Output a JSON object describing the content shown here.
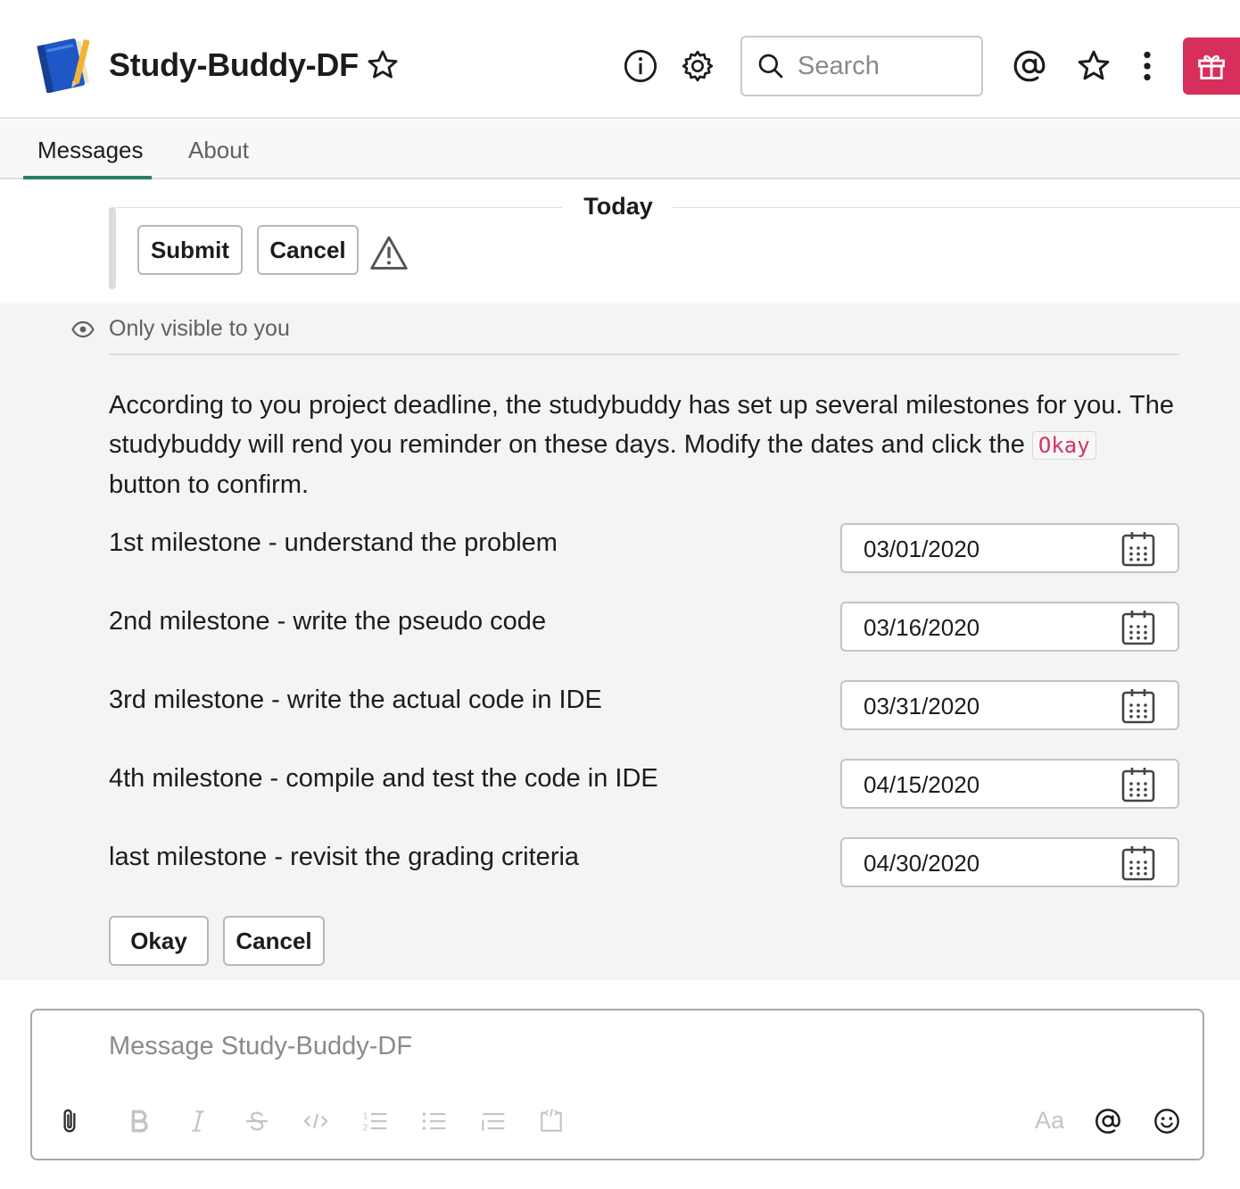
{
  "header": {
    "title": "Study-Buddy-DF",
    "search_placeholder": "Search"
  },
  "tabs": [
    {
      "label": "Messages",
      "active": true
    },
    {
      "label": "About",
      "active": false
    }
  ],
  "day_divider": "Today",
  "prev_message": {
    "submit_label": "Submit",
    "cancel_label": "Cancel"
  },
  "ephemeral": {
    "visibility_note": "Only visible to you",
    "body_part1": "According to you project deadline, the studybuddy has set up several milestones for you. The studybuddy will rend you reminder on these days. Modify the dates and click the ",
    "body_code": "Okay",
    "body_part2": " button to confirm.",
    "milestones": [
      {
        "label": "1st milestone - understand the problem",
        "date": "03/01/2020"
      },
      {
        "label": "2nd milestone - write the pseudo code",
        "date": "03/16/2020"
      },
      {
        "label": "3rd milestone - write the actual code in IDE",
        "date": "03/31/2020"
      },
      {
        "label": "4th milestone - compile and test the code in IDE",
        "date": "04/15/2020"
      },
      {
        "label": "last milestone - revisit the grading criteria",
        "date": "04/30/2020"
      }
    ],
    "okay_label": "Okay",
    "cancel_label": "Cancel"
  },
  "composer": {
    "placeholder": "Message Study-Buddy-DF",
    "format_label": "Aa"
  },
  "colors": {
    "accent_tab": "#2a7f62",
    "gift": "#d62f5b",
    "code_text": "#d1345b"
  }
}
